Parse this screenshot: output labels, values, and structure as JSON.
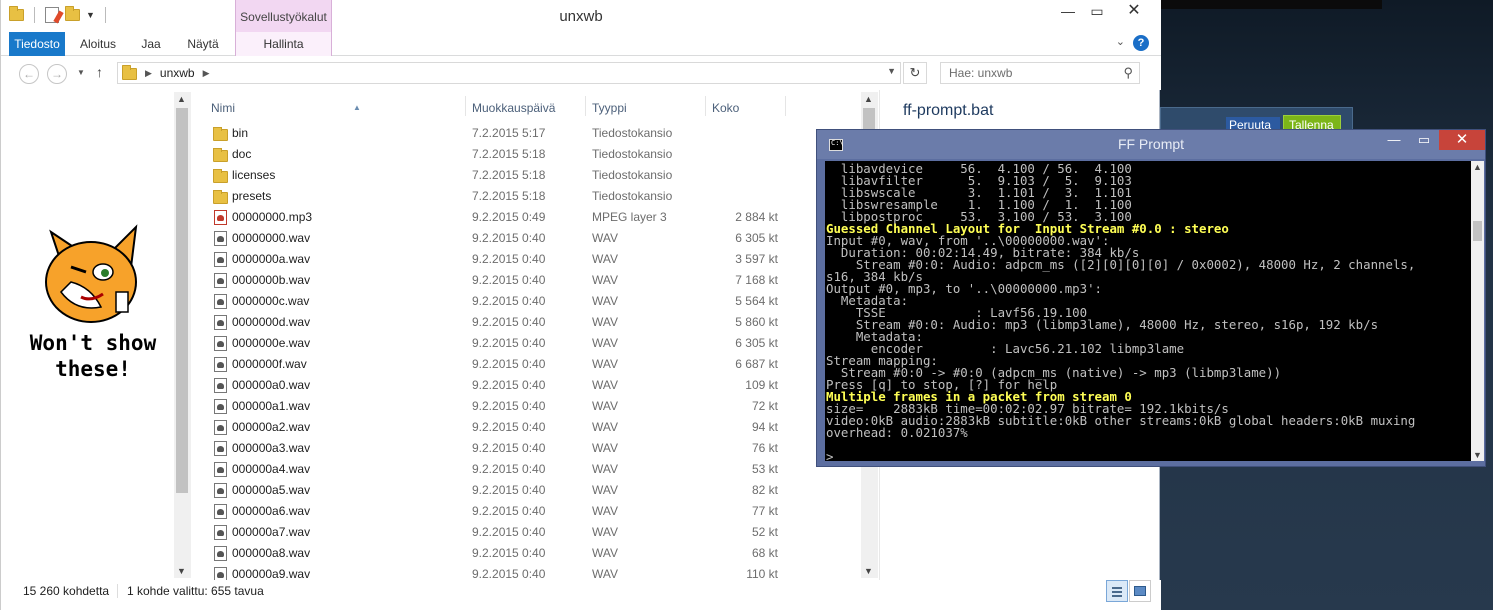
{
  "explorer": {
    "title": "unxwb",
    "context_tab_group": "Sovellustyökalut",
    "ribbon_tabs": [
      "Tiedosto",
      "Aloitus",
      "Jaa",
      "Näytä",
      "Hallinta"
    ],
    "address": {
      "crumbs": [
        "unxwb"
      ]
    },
    "search_placeholder": "Hae: unxwb",
    "columns": [
      "Nimi",
      "Muokkauspäivä",
      "Tyyppi",
      "Koko"
    ],
    "files": [
      {
        "name": "bin",
        "date": "7.2.2015 5:17",
        "type": "Tiedostokansio",
        "size": "",
        "icon": "folder-icon"
      },
      {
        "name": "doc",
        "date": "7.2.2015 5:18",
        "type": "Tiedostokansio",
        "size": "",
        "icon": "folder-icon"
      },
      {
        "name": "licenses",
        "date": "7.2.2015 5:18",
        "type": "Tiedostokansio",
        "size": "",
        "icon": "folder-icon"
      },
      {
        "name": "presets",
        "date": "7.2.2015 5:18",
        "type": "Tiedostokansio",
        "size": "",
        "icon": "folder-icon"
      },
      {
        "name": "00000000.mp3",
        "date": "9.2.2015 0:49",
        "type": "MPEG layer 3",
        "size": "2 884 kt",
        "icon": "mp3-file-icon"
      },
      {
        "name": "00000000.wav",
        "date": "9.2.2015 0:40",
        "type": "WAV",
        "size": "6 305 kt",
        "icon": "wav-file-icon"
      },
      {
        "name": "0000000a.wav",
        "date": "9.2.2015 0:40",
        "type": "WAV",
        "size": "3 597 kt",
        "icon": "wav-file-icon"
      },
      {
        "name": "0000000b.wav",
        "date": "9.2.2015 0:40",
        "type": "WAV",
        "size": "7 168 kt",
        "icon": "wav-file-icon"
      },
      {
        "name": "0000000c.wav",
        "date": "9.2.2015 0:40",
        "type": "WAV",
        "size": "5 564 kt",
        "icon": "wav-file-icon"
      },
      {
        "name": "0000000d.wav",
        "date": "9.2.2015 0:40",
        "type": "WAV",
        "size": "5 860 kt",
        "icon": "wav-file-icon"
      },
      {
        "name": "0000000e.wav",
        "date": "9.2.2015 0:40",
        "type": "WAV",
        "size": "6 305 kt",
        "icon": "wav-file-icon"
      },
      {
        "name": "0000000f.wav",
        "date": "9.2.2015 0:40",
        "type": "WAV",
        "size": "6 687 kt",
        "icon": "wav-file-icon"
      },
      {
        "name": "000000a0.wav",
        "date": "9.2.2015 0:40",
        "type": "WAV",
        "size": "109 kt",
        "icon": "wav-file-icon"
      },
      {
        "name": "000000a1.wav",
        "date": "9.2.2015 0:40",
        "type": "WAV",
        "size": "72 kt",
        "icon": "wav-file-icon"
      },
      {
        "name": "000000a2.wav",
        "date": "9.2.2015 0:40",
        "type": "WAV",
        "size": "94 kt",
        "icon": "wav-file-icon"
      },
      {
        "name": "000000a3.wav",
        "date": "9.2.2015 0:40",
        "type": "WAV",
        "size": "76 kt",
        "icon": "wav-file-icon"
      },
      {
        "name": "000000a4.wav",
        "date": "9.2.2015 0:40",
        "type": "WAV",
        "size": "53 kt",
        "icon": "wav-file-icon"
      },
      {
        "name": "000000a5.wav",
        "date": "9.2.2015 0:40",
        "type": "WAV",
        "size": "82 kt",
        "icon": "wav-file-icon"
      },
      {
        "name": "000000a6.wav",
        "date": "9.2.2015 0:40",
        "type": "WAV",
        "size": "77 kt",
        "icon": "wav-file-icon"
      },
      {
        "name": "000000a7.wav",
        "date": "9.2.2015 0:40",
        "type": "WAV",
        "size": "52 kt",
        "icon": "wav-file-icon"
      },
      {
        "name": "000000a8.wav",
        "date": "9.2.2015 0:40",
        "type": "WAV",
        "size": "68 kt",
        "icon": "wav-file-icon"
      },
      {
        "name": "000000a9.wav",
        "date": "9.2.2015 0:40",
        "type": "WAV",
        "size": "110 kt",
        "icon": "wav-file-icon"
      }
    ],
    "preview_title": "ff-prompt.bat",
    "mascot_caption_line1": "Won't show",
    "mascot_caption_line2": "these!",
    "status_count": "15 260 kohdetta",
    "status_selected": "1 kohde valittu: 655 tavua"
  },
  "background_window": {
    "cancel_label": "Peruuta",
    "save_label": "Tallenna"
  },
  "cmd": {
    "title": "FF Prompt",
    "lines": [
      {
        "t": "  libavdevice     56.  4.100 / 56.  4.100",
        "y": false
      },
      {
        "t": "  libavfilter      5.  9.103 /  5.  9.103",
        "y": false
      },
      {
        "t": "  libswscale       3.  1.101 /  3.  1.101",
        "y": false
      },
      {
        "t": "  libswresample    1.  1.100 /  1.  1.100",
        "y": false
      },
      {
        "t": "  libpostproc     53.  3.100 / 53.  3.100",
        "y": false
      },
      {
        "t": "Guessed Channel Layout for  Input Stream #0.0 : stereo",
        "y": true
      },
      {
        "t": "Input #0, wav, from '..\\00000000.wav':",
        "y": false
      },
      {
        "t": "  Duration: 00:02:14.49, bitrate: 384 kb/s",
        "y": false
      },
      {
        "t": "    Stream #0:0: Audio: adpcm_ms ([2][0][0][0] / 0x0002), 48000 Hz, 2 channels,",
        "y": false
      },
      {
        "t": "s16, 384 kb/s",
        "y": false
      },
      {
        "t": "Output #0, mp3, to '..\\00000000.mp3':",
        "y": false
      },
      {
        "t": "  Metadata:",
        "y": false
      },
      {
        "t": "    TSSE            : Lavf56.19.100",
        "y": false
      },
      {
        "t": "    Stream #0:0: Audio: mp3 (libmp3lame), 48000 Hz, stereo, s16p, 192 kb/s",
        "y": false
      },
      {
        "t": "    Metadata:",
        "y": false
      },
      {
        "t": "      encoder         : Lavc56.21.102 libmp3lame",
        "y": false
      },
      {
        "t": "Stream mapping:",
        "y": false
      },
      {
        "t": "  Stream #0:0 -> #0:0 (adpcm_ms (native) -> mp3 (libmp3lame))",
        "y": false
      },
      {
        "t": "Press [q] to stop, [?] for help",
        "y": false
      },
      {
        "t": "Multiple frames in a packet from stream 0",
        "y": true
      },
      {
        "t": "size=    2883kB time=00:02:02.97 bitrate= 192.1kbits/s",
        "y": false
      },
      {
        "t": "video:0kB audio:2883kB subtitle:0kB other streams:0kB global headers:0kB muxing",
        "y": false
      },
      {
        "t": "overhead: 0.021037%",
        "y": false
      },
      {
        "t": "",
        "y": false
      },
      {
        "t": ">_",
        "y": false
      }
    ]
  }
}
